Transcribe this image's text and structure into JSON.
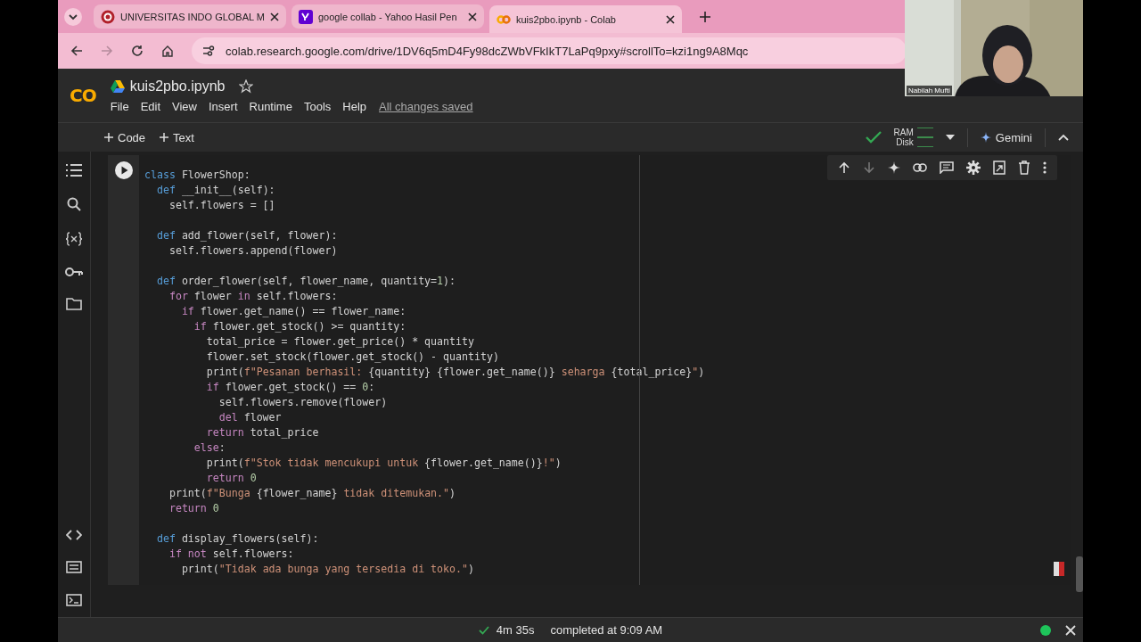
{
  "browser": {
    "tabs": [
      {
        "title": "UNIVERSITAS INDO GLOBAL M",
        "kind": "university",
        "selected": false
      },
      {
        "title": "google collab - Yahoo Hasil Pen",
        "kind": "yahoo",
        "selected": false
      },
      {
        "title": "kuis2pbo.ipynb - Colab",
        "kind": "colab",
        "selected": true
      }
    ],
    "url": "colab.research.google.com/drive/1DV6q5mD4Fy98dcZWbVFkIkT7LaPq9pxy#scrollTo=kzi1ng9A8Mqc"
  },
  "colab": {
    "logo": "CO",
    "title": "kuis2pbo.ipynb",
    "menu": [
      "File",
      "Edit",
      "View",
      "Insert",
      "Runtime",
      "Tools",
      "Help"
    ],
    "save_status": "All changes saved"
  },
  "toolbar": {
    "buttons": [
      "Code",
      "Text"
    ],
    "resources": [
      "RAM",
      "Disk"
    ],
    "assistant": "Gemini"
  },
  "cell": {
    "lines": [
      {
        "kind": "code",
        "segments": [
          {
            "kind": "kw",
            "text": "class"
          },
          {
            "kind": "plain",
            "text": " FlowerShop:"
          }
        ]
      },
      {
        "kind": "code",
        "segments": [
          {
            "kind": "kw",
            "text": "  def"
          },
          {
            "kind": "plain",
            "text": " __init__(self):"
          }
        ]
      },
      {
        "kind": "code",
        "segments": [
          {
            "kind": "plain",
            "text": "    self.flowers = []"
          }
        ]
      },
      {
        "kind": "blank"
      },
      {
        "kind": "code",
        "segments": [
          {
            "kind": "kw",
            "text": "  def"
          },
          {
            "kind": "plain",
            "text": " add_flower(self, flower):"
          }
        ]
      },
      {
        "kind": "code",
        "segments": [
          {
            "kind": "plain",
            "text": "    self.flowers.append(flower)"
          }
        ]
      },
      {
        "kind": "blank"
      },
      {
        "kind": "code",
        "segments": [
          {
            "kind": "kw",
            "text": "  def"
          },
          {
            "kind": "plain",
            "text": " order_flower(self, flower_name, quantity="
          },
          {
            "kind": "num",
            "text": "1"
          },
          {
            "kind": "plain",
            "text": "):"
          }
        ]
      },
      {
        "kind": "code",
        "segments": [
          {
            "kind": "ctl",
            "text": "    for"
          },
          {
            "kind": "plain",
            "text": " flower "
          },
          {
            "kind": "ctl",
            "text": "in"
          },
          {
            "kind": "plain",
            "text": " self.flowers:"
          }
        ]
      },
      {
        "kind": "code",
        "segments": [
          {
            "kind": "ctl",
            "text": "      if"
          },
          {
            "kind": "plain",
            "text": " flower.get_name() == flower_name:"
          }
        ]
      },
      {
        "kind": "code",
        "segments": [
          {
            "kind": "ctl",
            "text": "        if"
          },
          {
            "kind": "plain",
            "text": " flower.get_stock() >= quantity:"
          }
        ]
      },
      {
        "kind": "code",
        "segments": [
          {
            "kind": "plain",
            "text": "          total_price = flower.get_price() * quantity"
          }
        ]
      },
      {
        "kind": "code",
        "segments": [
          {
            "kind": "plain",
            "text": "          flower.set_stock(flower.get_stock() - quantity)"
          }
        ]
      },
      {
        "kind": "code",
        "segments": [
          {
            "kind": "plain",
            "text": "          print("
          },
          {
            "kind": "str",
            "text": "f\"Pesanan berhasil: "
          },
          {
            "kind": "plain",
            "text": "{quantity} {flower.get_name()}"
          },
          {
            "kind": "str",
            "text": " seharga "
          },
          {
            "kind": "plain",
            "text": "{total_price}"
          },
          {
            "kind": "str",
            "text": "\""
          },
          {
            "kind": "plain",
            "text": ")"
          }
        ]
      },
      {
        "kind": "code",
        "segments": [
          {
            "kind": "ctl",
            "text": "          if"
          },
          {
            "kind": "plain",
            "text": " flower.get_stock() == "
          },
          {
            "kind": "num",
            "text": "0"
          },
          {
            "kind": "plain",
            "text": ":"
          }
        ]
      },
      {
        "kind": "code",
        "segments": [
          {
            "kind": "plain",
            "text": "            self.flowers.remove(flower)"
          }
        ]
      },
      {
        "kind": "code",
        "segments": [
          {
            "kind": "ctl",
            "text": "            del"
          },
          {
            "kind": "plain",
            "text": " flower"
          }
        ]
      },
      {
        "kind": "code",
        "segments": [
          {
            "kind": "ctl",
            "text": "          return"
          },
          {
            "kind": "plain",
            "text": " total_price"
          }
        ]
      },
      {
        "kind": "code",
        "segments": [
          {
            "kind": "ctl",
            "text": "        else"
          },
          {
            "kind": "plain",
            "text": ":"
          }
        ]
      },
      {
        "kind": "code",
        "segments": [
          {
            "kind": "plain",
            "text": "          print("
          },
          {
            "kind": "str",
            "text": "f\"Stok tidak mencukupi untuk "
          },
          {
            "kind": "plain",
            "text": "{flower.get_name()}"
          },
          {
            "kind": "str",
            "text": "!\""
          },
          {
            "kind": "plain",
            "text": ")"
          }
        ]
      },
      {
        "kind": "code",
        "segments": [
          {
            "kind": "ctl",
            "text": "          return"
          },
          {
            "kind": "num",
            "text": " 0"
          }
        ]
      },
      {
        "kind": "code",
        "segments": [
          {
            "kind": "plain",
            "text": "    print("
          },
          {
            "kind": "str",
            "text": "f\"Bunga "
          },
          {
            "kind": "plain",
            "text": "{flower_name}"
          },
          {
            "kind": "str",
            "text": " tidak ditemukan.\""
          },
          {
            "kind": "plain",
            "text": ")"
          }
        ]
      },
      {
        "kind": "code",
        "segments": [
          {
            "kind": "ctl",
            "text": "    return"
          },
          {
            "kind": "num",
            "text": " 0"
          }
        ]
      },
      {
        "kind": "blank"
      },
      {
        "kind": "code",
        "segments": [
          {
            "kind": "kw",
            "text": "  def"
          },
          {
            "kind": "plain",
            "text": " display_flowers(self):"
          }
        ]
      },
      {
        "kind": "code",
        "segments": [
          {
            "kind": "ctl",
            "text": "    if not"
          },
          {
            "kind": "plain",
            "text": " self.flowers:"
          }
        ]
      },
      {
        "kind": "code",
        "segments": [
          {
            "kind": "plain",
            "text": "      print("
          },
          {
            "kind": "str",
            "text": "\"Tidak ada bunga yang tersedia di toko.\""
          },
          {
            "kind": "plain",
            "text": ")"
          }
        ]
      }
    ]
  },
  "status": {
    "duration": "4m 35s",
    "completed": "completed at 9:09 AM"
  },
  "webcam": {
    "name": "Nabilah Mufti"
  }
}
